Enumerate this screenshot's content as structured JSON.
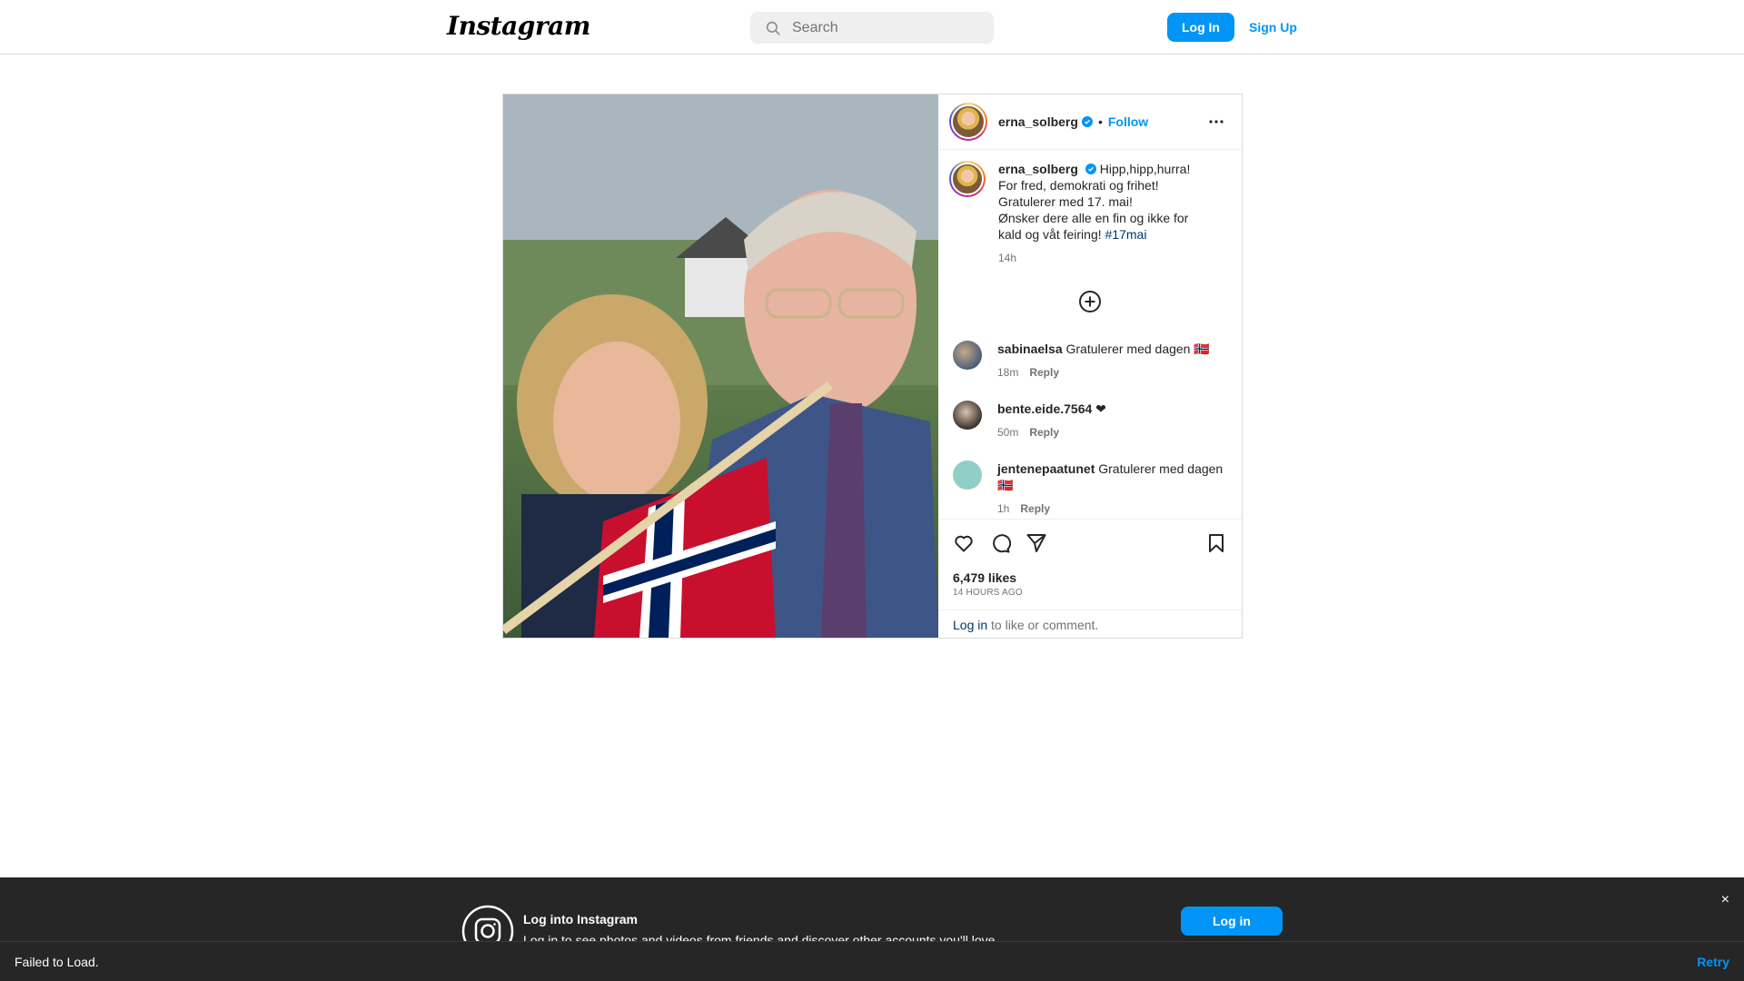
{
  "header": {
    "logo": "Instagram",
    "search_placeholder": "Search",
    "login_label": "Log In",
    "signup_label": "Sign Up"
  },
  "post": {
    "username": "erna_solberg",
    "follow_label": "Follow",
    "separator": "•",
    "caption": {
      "username": "erna_solberg",
      "line1": "Hipp,hipp,hurra!",
      "line2": "For fred, demokrati og frihet!",
      "line3": "Gratulerer med 17. mai!",
      "line4": "Ønsker dere alle en fin og ikke for",
      "line5": "kald og våt feiring!",
      "hashtag": "#17mai",
      "time": "14h"
    },
    "comments": [
      {
        "username": "sabinaelsa",
        "text": "Gratulerer med dagen 🇳🇴",
        "time": "18m",
        "reply": "Reply"
      },
      {
        "username": "bente.eide.7564",
        "text": "❤",
        "time": "50m",
        "reply": "Reply"
      },
      {
        "username": "jentenepaatunet",
        "text": "Gratulerer med dagen",
        "text2": "🇳🇴",
        "time": "1h",
        "reply": "Reply"
      }
    ],
    "likes": "6,479 likes",
    "posted_ago": "14 HOURS AGO",
    "login_prompt": {
      "link": "Log in",
      "rest": " to like or comment."
    }
  },
  "icons": {
    "search": "search-icon",
    "verified": "verified-badge-icon",
    "more": "more-options-icon",
    "load_more": "plus-circle-icon",
    "like": "heart-icon",
    "comment": "comment-icon",
    "share": "send-icon",
    "save": "bookmark-icon",
    "instagram": "instagram-logo-icon",
    "close": "close-icon"
  },
  "banner": {
    "title": "Log into Instagram",
    "subtitle": "Log in to see photos and videos from friends and discover other accounts you'll love.",
    "login_label": "Log in",
    "close": "×"
  },
  "error_bar": {
    "text": "Failed to Load.",
    "retry": "Retry"
  },
  "colors": {
    "accent": "#0095f6",
    "text": "#262626",
    "muted": "#737373",
    "hashtag": "#00376b"
  }
}
